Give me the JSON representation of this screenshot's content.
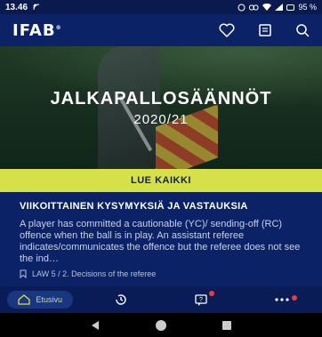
{
  "status_bar": {
    "time": "13.46",
    "battery": "95 %"
  },
  "app_bar": {
    "logo": "IFAB",
    "logo_mark": "®",
    "icons": [
      "heart-icon",
      "book-icon",
      "search-icon"
    ]
  },
  "hero": {
    "title": "JALKAPALLOSÄÄNNÖT",
    "subtitle": "2020/21"
  },
  "read_all": {
    "label": "LUE KAIKKI"
  },
  "weekly": {
    "heading": "VIIKOITTAINEN KYSYMYKSIÄ JA VASTAUKSIA",
    "body": "A player has committed a cautionable (YC)/ sending-off (RC) offence when the ball is in play. An assistant referee indicates/communicates the offence but the referee does not see the ind…",
    "law": "LAW 5 / 2. Decisions of the referee"
  },
  "bottom_nav": {
    "items": [
      {
        "label": "Etusivu",
        "icon": "home-icon",
        "active": true
      },
      {
        "label": "",
        "icon": "history-icon",
        "active": false
      },
      {
        "label": "",
        "icon": "quiz-icon",
        "active": false
      },
      {
        "label": "",
        "icon": "more-icon",
        "active": false
      }
    ]
  },
  "colors": {
    "background": "#0c2266",
    "accent": "#d6e14a",
    "badge": "#e5403c"
  }
}
